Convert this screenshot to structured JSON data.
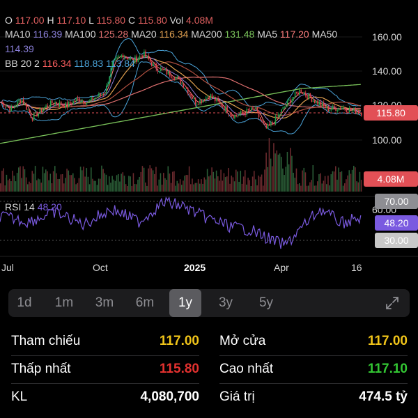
{
  "colors": {
    "candle_up": "#1fa24a",
    "candle_down": "#e1414b",
    "ma10": "#8a7fd8",
    "ma100": "#e07070",
    "ma20": "#e0a050",
    "ma200": "#7ac35a",
    "ma5": "#ff7e7e",
    "ma50": "#b05040",
    "bb": "#4aa3d8",
    "rsi": "#7a5ae0",
    "price_badge": "#e25056",
    "accent_yellow": "#f0c419",
    "red": "#e3312f",
    "green": "#33c633"
  },
  "ohlc": {
    "o_label": "O",
    "o": "117.00",
    "h_label": "H",
    "h": "117.10",
    "l_label": "L",
    "l": "115.80",
    "c_label": "C",
    "c": "115.80",
    "vol_label": "Vol",
    "vol": "4.08M"
  },
  "ma_line": {
    "ma10_label": "MA10",
    "ma10": "116.39",
    "ma100_label": "MA100",
    "ma100": "125.28",
    "ma20_label": "MA20",
    "ma20": "116.34",
    "ma200_label": "MA200",
    "ma200": "131.48",
    "ma5_label": "MA5",
    "ma5": "117.20",
    "ma50_label": "MA50",
    "ma50": "114.39"
  },
  "bb": {
    "label": "BB 20 2",
    "upper": "116.34",
    "middle": "118.83",
    "lower": "113.84"
  },
  "rsi": {
    "label": "RSI 14",
    "value": "48.20",
    "upper_badge": "70.00",
    "mid_badge": "48.20",
    "lower_badge": "30.00",
    "tick_60": "60.00"
  },
  "badges": {
    "price": "115.80",
    "volume": "4.08M"
  },
  "price_axis": [
    "160.00",
    "140.00",
    "120.00",
    "100.00"
  ],
  "time_axis": [
    "Jul",
    "Oct",
    "2025",
    "Apr",
    "16"
  ],
  "ranges": [
    {
      "label": "1d",
      "active": false
    },
    {
      "label": "1m",
      "active": false
    },
    {
      "label": "3m",
      "active": false
    },
    {
      "label": "6m",
      "active": false
    },
    {
      "label": "1y",
      "active": true
    },
    {
      "label": "3y",
      "active": false
    },
    {
      "label": "5y",
      "active": false
    }
  ],
  "expand_icon": "expand-icon",
  "stats": {
    "ref_label": "Tham chiếu",
    "ref_value": "117.00",
    "open_label": "Mở cửa",
    "open_value": "117.00",
    "low_label": "Thấp nhất",
    "low_value": "115.80",
    "high_label": "Cao nhất",
    "high_value": "117.10",
    "vol_label": "KL",
    "vol_value": "4,080,700",
    "val_label": "Giá trị",
    "val_value": "474.5 tỷ"
  }
}
